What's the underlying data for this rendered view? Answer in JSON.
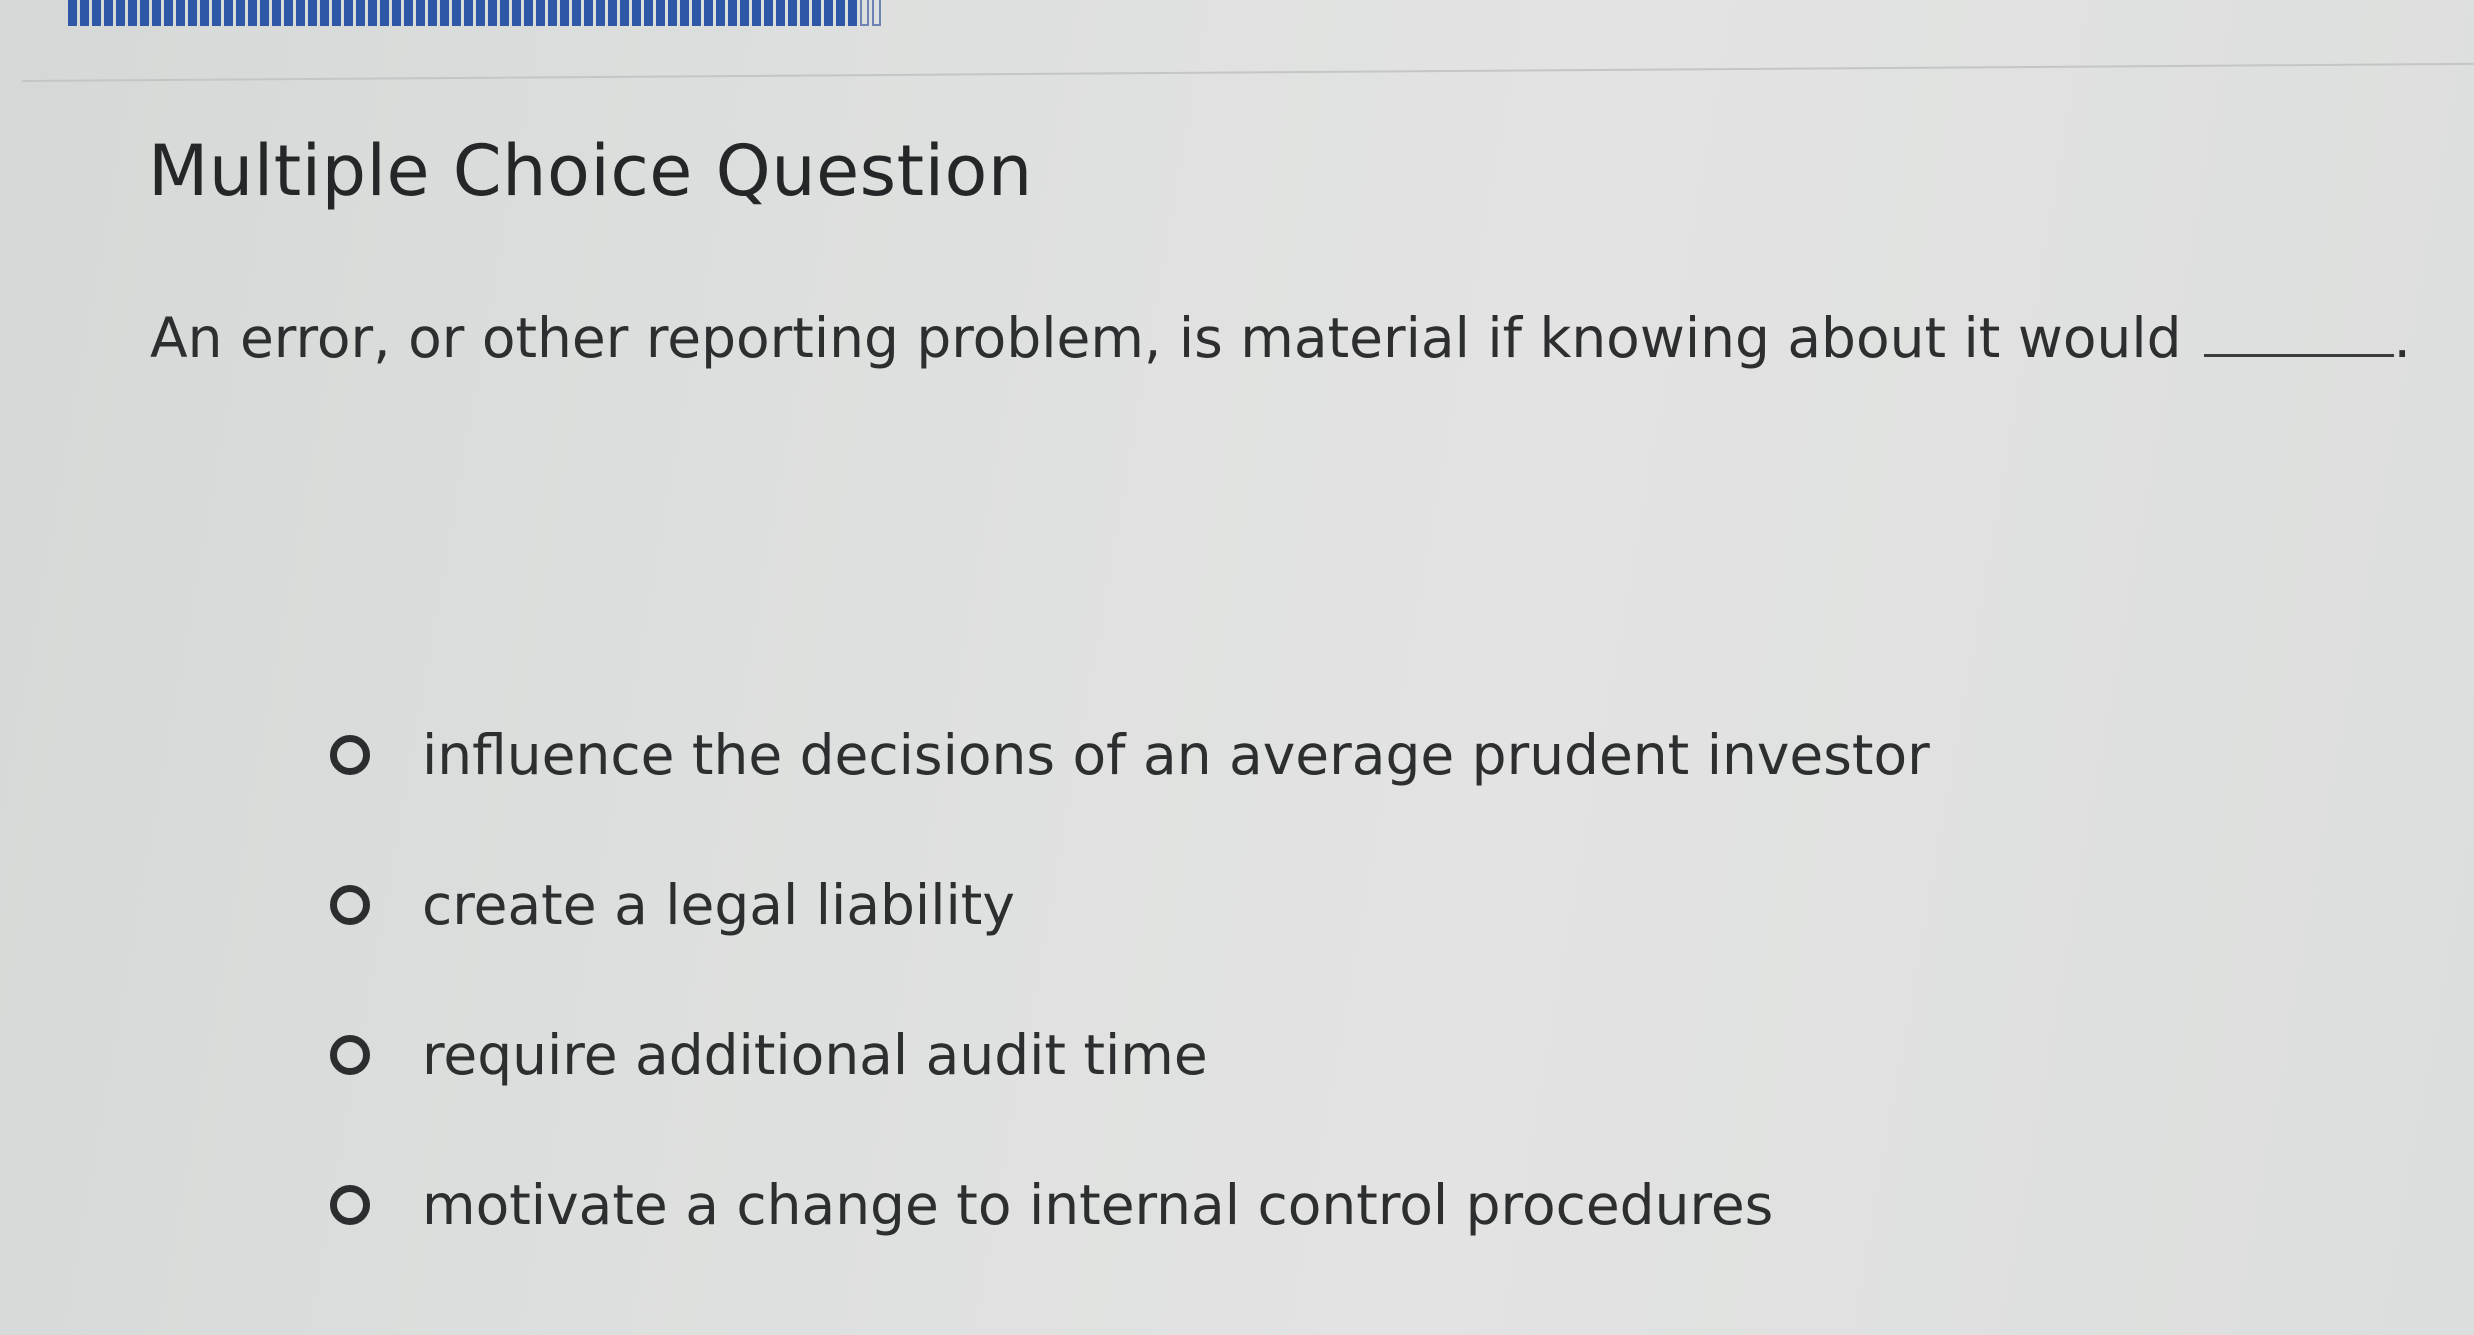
{
  "header": {
    "title": "Multiple Choice Question"
  },
  "question": {
    "text": "An error, or other reporting problem, is material if knowing about it would",
    "end_punctuation": "."
  },
  "options": [
    {
      "label": "influence the decisions of an average prudent investor",
      "selected": false
    },
    {
      "label": "create a legal liability",
      "selected": false
    },
    {
      "label": "require additional audit time",
      "selected": false
    },
    {
      "label": "motivate a change to internal control procedures",
      "selected": false
    }
  ],
  "colors": {
    "progress_fill": "#2f57a8",
    "text": "#2c2e30",
    "background": "#dddfde"
  }
}
